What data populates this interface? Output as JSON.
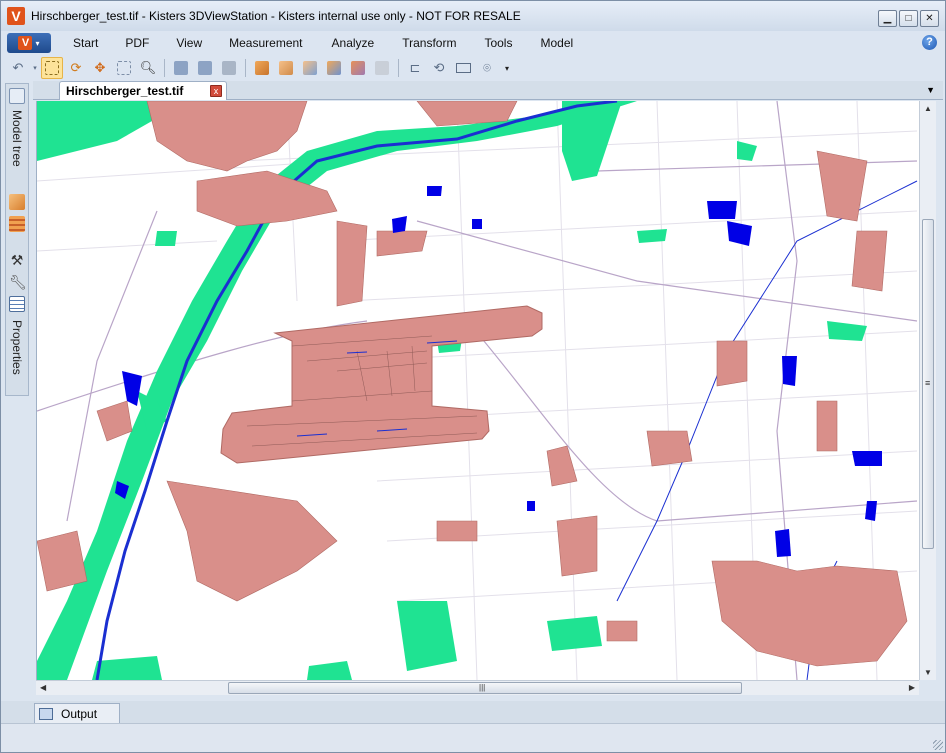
{
  "window": {
    "title": "Hirschberger_test.tif - Kisters 3DViewStation - Kisters internal use only - NOT FOR RESALE",
    "app_icon_letter": "V",
    "minimize_glyph": "▁",
    "maximize_glyph": "□",
    "close_glyph": "✕"
  },
  "menu": {
    "app_button_letter": "V",
    "app_button_chevron": "▾",
    "items": [
      "Start",
      "PDF",
      "View",
      "Measurement",
      "Analyze",
      "Transform",
      "Tools",
      "Model"
    ],
    "help_glyph": "?"
  },
  "sidebar": {
    "model_tree_label": "Model tree",
    "properties_label": "Properties"
  },
  "document": {
    "tab_label": "Hirschberger_test.tif",
    "tab_close_glyph": "x",
    "tab_dropdown_glyph": "▼"
  },
  "scrollbars": {
    "v_up": "▲",
    "v_down": "▼",
    "v_grip": "≡",
    "h_left": "◀",
    "h_right": "▶",
    "h_grip": "|||"
  },
  "output": {
    "tab_label": "Output"
  },
  "colors": {
    "urban": "#d98f8a",
    "urban_edge": "#b06a64",
    "forest": "#1fe392",
    "water": "#1a2fd1",
    "water_body": "#0000e6",
    "road": "#b9a5c8"
  },
  "icons": {
    "toolbar": [
      "undo-icon",
      "select-zoom-icon",
      "rotate-icon",
      "pan-icon",
      "select-icon",
      "zoom-icon",
      "fit-view-icon",
      "fit-selection-icon",
      "fit-all-icon",
      "view-front-icon",
      "view-back-icon",
      "view-left-icon",
      "view-right-icon",
      "view-top-icon",
      "view-iso-icon",
      "measure-icon",
      "reset-icon",
      "rectangle-icon",
      "lasso-icon",
      "toolbar-overflow-icon"
    ]
  }
}
